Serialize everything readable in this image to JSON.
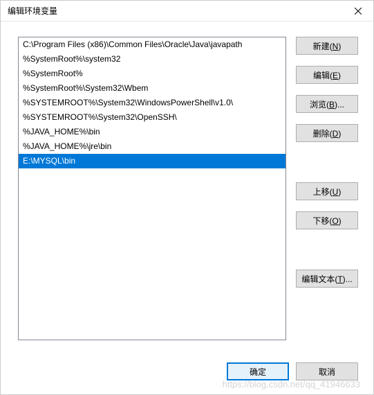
{
  "titlebar": {
    "title": "编辑环境变量"
  },
  "list": {
    "items": [
      {
        "text": "C:\\Program Files (x86)\\Common Files\\Oracle\\Java\\javapath",
        "selected": false
      },
      {
        "text": "%SystemRoot%\\system32",
        "selected": false
      },
      {
        "text": "%SystemRoot%",
        "selected": false
      },
      {
        "text": "%SystemRoot%\\System32\\Wbem",
        "selected": false
      },
      {
        "text": "%SYSTEMROOT%\\System32\\WindowsPowerShell\\v1.0\\",
        "selected": false
      },
      {
        "text": "%SYSTEMROOT%\\System32\\OpenSSH\\",
        "selected": false
      },
      {
        "text": "%JAVA_HOME%\\bin",
        "selected": false
      },
      {
        "text": "%JAVA_HOME%\\jre\\bin",
        "selected": false
      },
      {
        "text": "E:\\MYSQL\\bin",
        "selected": true
      }
    ]
  },
  "buttons": {
    "new": {
      "pre": "新建(",
      "key": "N",
      "post": ")"
    },
    "edit": {
      "pre": "编辑(",
      "key": "E",
      "post": ")"
    },
    "browse": {
      "pre": "浏览(",
      "key": "B",
      "post": ")..."
    },
    "delete": {
      "pre": "删除(",
      "key": "D",
      "post": ")"
    },
    "moveup": {
      "pre": "上移(",
      "key": "U",
      "post": ")"
    },
    "movedown": {
      "pre": "下移(",
      "key": "O",
      "post": ")"
    },
    "edittext": {
      "pre": "编辑文本(",
      "key": "T",
      "post": ")..."
    },
    "ok": "确定",
    "cancel": "取消"
  },
  "watermark": "https://blog.csdn.net/qq_41946633"
}
